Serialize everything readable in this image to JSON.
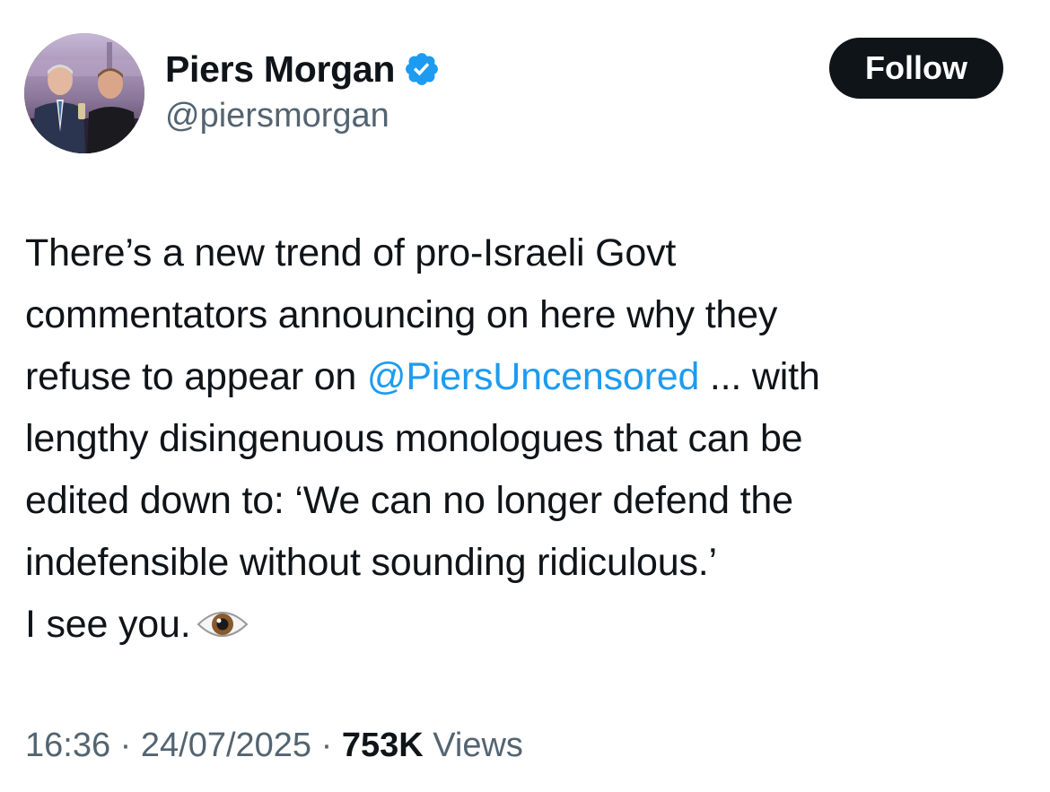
{
  "author": {
    "display_name": "Piers Morgan",
    "handle": "@piersmorgan",
    "verified": true,
    "verified_color": "#1d9bf0"
  },
  "follow_button": {
    "label": "Follow"
  },
  "tweet": {
    "line1": "There’s a new trend of pro-Israeli Govt",
    "line2": "commentators announcing on here why they",
    "line3_before": "refuse to appear on ",
    "line3_mention": "@PiersUncensored",
    "line3_after": " ... with",
    "line4": "lengthy disingenuous monologues that can be",
    "line5": "edited down to: ‘We can no longer defend the",
    "line6": "indefensible without sounding ridiculous.’",
    "line7": "I see you.",
    "emoji": "eye-icon"
  },
  "meta": {
    "time": "16:36",
    "separator1": " · ",
    "date": "24/07/2025",
    "separator2": " · ",
    "views_count": "753K",
    "views_label": " Views"
  },
  "colors": {
    "text": "#0f1419",
    "secondary": "#536471",
    "link": "#1d9bf0",
    "button_bg": "#0f1419"
  }
}
